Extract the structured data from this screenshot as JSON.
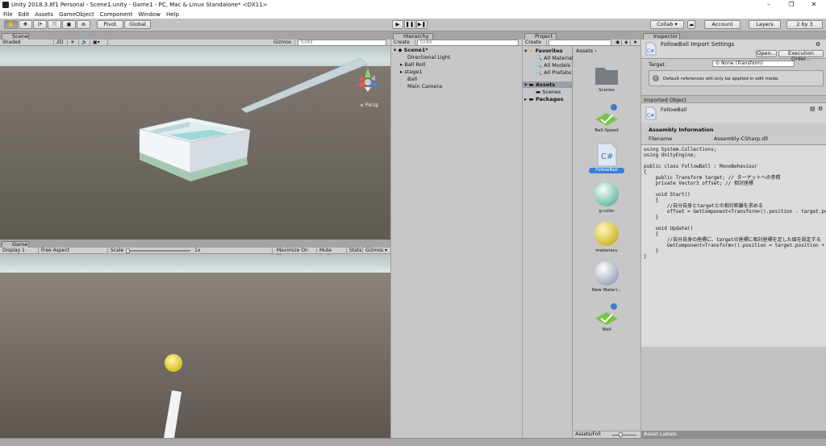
{
  "window": {
    "title": "Unity 2018.3.8f1 Personal - Scene1.unity - Game1 - PC, Mac & Linux Standalone* <DX11>",
    "controls": [
      "–",
      "❐",
      "✕"
    ]
  },
  "menu": [
    "File",
    "Edit",
    "Assets",
    "GameObject",
    "Component",
    "Window",
    "Help"
  ],
  "toolbar": {
    "pivot": "Pivot",
    "global": "Global",
    "collab": "Collab ▾",
    "account": "Account",
    "layers": "Layers",
    "layout": "2 by 3"
  },
  "scene": {
    "tab": "Scene",
    "shading": "Shaded",
    "mode2d": "2D",
    "gizmos": "Gizmos ▾",
    "search_placeholder": "GrAll",
    "persp": "≤ Persp"
  },
  "game": {
    "tab": "Game",
    "display": "Display 1",
    "aspect": "Free Aspect",
    "scale_label": "Scale",
    "scale_value": "1x",
    "maximize": "Maximize On Play",
    "mute": "Mute Audio",
    "stats": "Stats",
    "gizmos": "Gizmos ▾"
  },
  "hierarchy": {
    "tab": "Hierarchy",
    "create": "Create ▾",
    "search_placeholder": "GrAll",
    "scene": "Scene1*",
    "items": [
      "Directional Light",
      "Ball Roll",
      "stage1",
      "Ball",
      "Main Camera"
    ]
  },
  "project": {
    "tab": "Project",
    "create": "Create ▾",
    "favorites": "Favorites",
    "favorite_items": [
      "All Materials",
      "All Models",
      "All Prefabs"
    ],
    "assets_root": "Assets",
    "assets_sub": [
      "Scenes"
    ],
    "packages": "Packages",
    "breadcrumb": "Assets",
    "asset_items": [
      "Scenes",
      "Ball-Speed",
      "FollowBall",
      "g-color",
      "materiaru",
      "New Materi...",
      "Wall"
    ],
    "footer": "Assets/Foll"
  },
  "inspector": {
    "tab": "Inspector",
    "import_title": "FollowBall Import Settings",
    "open": "Open...",
    "exec_order": "Execution Order...",
    "target_label": "Target",
    "target_value": "None (Transform)",
    "info": "Default references will only be applied in edit mode.",
    "imported_object": "Imported Object",
    "object_name": "FollowBall",
    "assembly_info": "Assembly Information",
    "filename_label": "Filename",
    "filename_value": "Assembly-CSharp.dll",
    "code_lines": [
      "using System.Collections;",
      "using UnityEngine;",
      "",
      "public class FollowBall : MonoBehaviour",
      "{",
      "    public Transform target; // ターゲットへの参照",
      "    private Vector3 offset; // 相対座標",
      "",
      "    void Start()",
      "    {",
      "        //自分自身とtargetとの相対距離を求める",
      "        offset = GetComponent<Transform>().position - target.position;",
      "    }",
      "",
      "    void Update()",
      "    {",
      "        //自分自身の座標に、targetの座標に相対座標を足した値を設定する",
      "        GetComponent<Transform>().position = target.position + offset;",
      "    }",
      "}"
    ],
    "asset_labels": "Asset Labels"
  }
}
